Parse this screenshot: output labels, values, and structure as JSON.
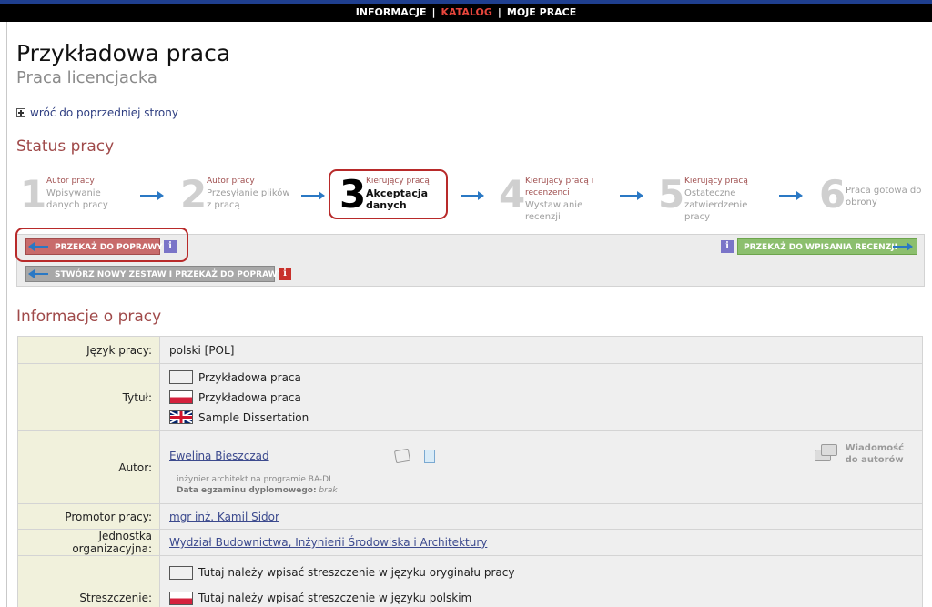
{
  "topnav": {
    "items": [
      {
        "label": "INFORMACJE",
        "active": false
      },
      {
        "label": "KATALOG",
        "active": true
      },
      {
        "label": "MOJE PRACE",
        "active": false
      }
    ],
    "separator": "|",
    "active_color": "#e8463c"
  },
  "page": {
    "title": "Przykładowa praca",
    "subtitle": "Praca licencjacka",
    "back_link": "wróć do poprzedniej strony"
  },
  "status": {
    "heading": "Status pracy",
    "steps": [
      {
        "num": "1",
        "role": "Autor pracy",
        "desc": "Wpisywanie danych pracy"
      },
      {
        "num": "2",
        "role": "Autor pracy",
        "desc": "Przesyłanie plików z pracą"
      },
      {
        "num": "3",
        "role": "Kierujący pracą",
        "desc": "Akceptacja danych"
      },
      {
        "num": "4",
        "role": "Kierujący pracą i recenzenci",
        "desc": "Wystawianie recenzji"
      },
      {
        "num": "5",
        "role": "Kierujący pracą",
        "desc": "Ostateczne zatwierdzenie pracy"
      },
      {
        "num": "6",
        "role": "",
        "desc": "Praca gotowa do obrony"
      }
    ],
    "current_step": 3
  },
  "actions": {
    "return_label": "PRZEKAŻ DO POPRAWY",
    "new_set_label": "STWÓRZ NOWY ZESTAW I PRZEKAŻ DO POPRAWY",
    "forward_label": "PRZEKAŻ DO WPISANIA RECENZJI",
    "info_glyph": "i",
    "highlight_color": "#b82a2a"
  },
  "info": {
    "heading": "Informacje o pracy",
    "language_label": "Język pracy:",
    "language_value": "polski [POL]",
    "title_label": "Tytuł:",
    "titles": [
      {
        "flag": "blank",
        "text": "Przykładowa praca"
      },
      {
        "flag": "pl",
        "text": "Przykładowa praca"
      },
      {
        "flag": "uk",
        "text": "Sample Dissertation"
      }
    ],
    "author_label": "Autor:",
    "author_name": "Ewelina Bieszczad",
    "author_degree": "inżynier architekt na programie BA-DI",
    "exam_date_label": "Data egzaminu dyplomowego:",
    "exam_date_value": "brak",
    "message_label_1": "Wiadomość",
    "message_label_2": "do autorów",
    "promoter_label": "Promotor pracy:",
    "promoter_value": "mgr inż. Kamil Sidor",
    "unit_label": "Jednostka organizacyjna:",
    "unit_value": "Wydział Budownictwa, Inżynierii Środowiska i Architektury",
    "abstract_label": "Streszczenie:",
    "abstracts": [
      {
        "flag": "blank",
        "text": "Tutaj należy wpisać streszczenie w języku oryginału pracy"
      },
      {
        "flag": "pl",
        "text": "Tutaj należy wpisać streszczenie w języku polskim"
      }
    ]
  }
}
